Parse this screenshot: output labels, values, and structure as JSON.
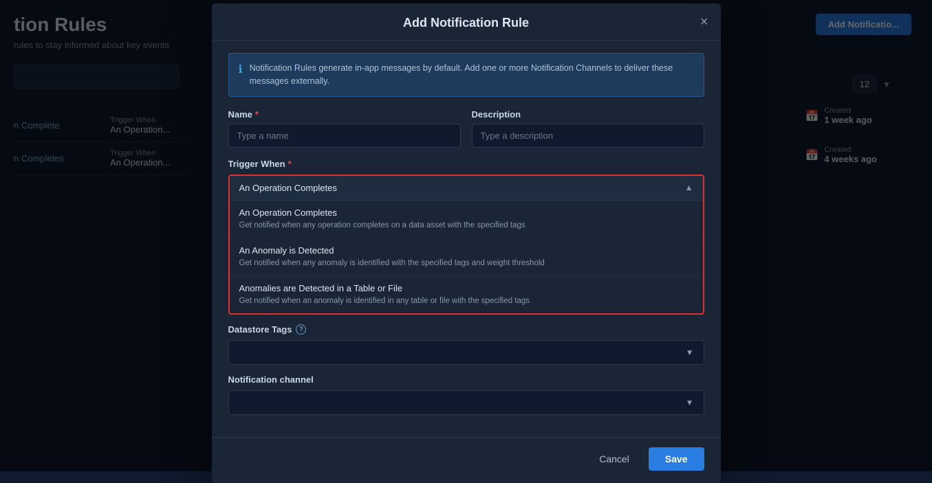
{
  "page": {
    "title": "tion Rules",
    "subtitle": "rules to stay informed about key events"
  },
  "background": {
    "rows": [
      {
        "name": "n Complete",
        "trigger_label": "Trigger When",
        "trigger_value": "An Operation..."
      },
      {
        "name": "n Completes",
        "trigger_label": "Trigger When",
        "trigger_value": "An Operation..."
      }
    ],
    "created_items": [
      {
        "label": "Created",
        "value": "1 week ago"
      },
      {
        "label": "Created",
        "value": "4 weeks ago"
      }
    ],
    "pagination_value": "12",
    "add_button_label": "Add Notificatio..."
  },
  "modal": {
    "title": "Add Notification Rule",
    "close_label": "×",
    "info_text": "Notification Rules generate in-app messages by default. Add one or more Notification Channels to deliver these messages externally.",
    "name_label": "Name",
    "name_placeholder": "Type a name",
    "description_label": "Description",
    "description_placeholder": "Type a description",
    "trigger_when_label": "Trigger When",
    "trigger_selected": "An Operation Completes",
    "trigger_options": [
      {
        "title": "An Operation Completes",
        "desc": "Get notified when any operation completes on a data asset with the specified tags"
      },
      {
        "title": "An Anomaly is Detected",
        "desc": "Get notified when any anomaly is identified with the specified tags and weight threshold"
      },
      {
        "title": "Anomalies are Detected in a Table or File",
        "desc": "Get notified when an anomaly is identified in any table or file with the specified tags"
      }
    ],
    "datastore_tags_label": "Datastore Tags",
    "notification_channel_label": "Notification channel",
    "cancel_label": "Cancel",
    "save_label": "Save"
  }
}
